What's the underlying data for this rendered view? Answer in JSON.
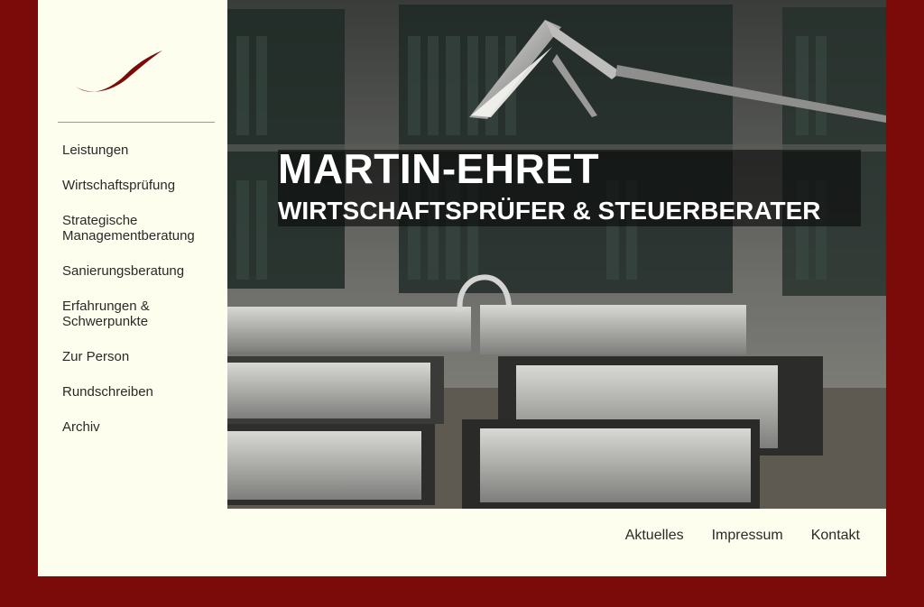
{
  "brand": {
    "accent_color": "#7a0b09",
    "background_color": "#fefeee"
  },
  "sidebar": {
    "items": [
      {
        "label": "Leistungen"
      },
      {
        "label": "Wirtschaftsprüfung"
      },
      {
        "label": "Strategische Managementberatung"
      },
      {
        "label": "Sanierungsberatung"
      },
      {
        "label": "Erfahrungen & Schwerpunkte"
      },
      {
        "label": "Zur Person"
      },
      {
        "label": "Rundschreiben"
      },
      {
        "label": "Archiv"
      }
    ]
  },
  "hero": {
    "title": "MARTIN-EHRET",
    "subtitle": "WIRTSCHAFTSPRÜFER & STEUERBERATER"
  },
  "footer": {
    "links": [
      {
        "label": "Aktuelles"
      },
      {
        "label": "Impressum"
      },
      {
        "label": "Kontakt"
      }
    ]
  }
}
